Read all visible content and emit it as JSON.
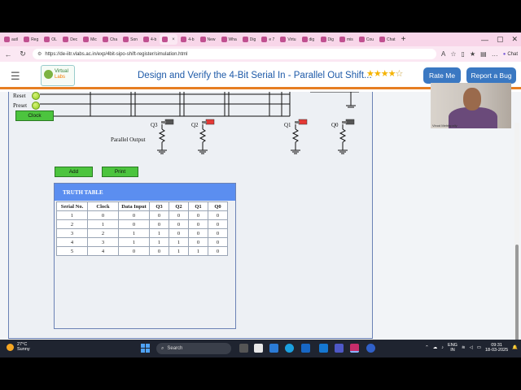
{
  "browser": {
    "tabs": [
      "autl",
      "Reg",
      "OL",
      "Dec",
      "Mic",
      "Cha",
      "Son",
      "4-b",
      "",
      "4-b",
      "New",
      "Wha",
      "Dig",
      "e 7",
      "Virtu",
      "dig",
      "Dig",
      "mis",
      "Cou",
      "Chat"
    ],
    "active_tab": 8,
    "url": "https://de-iitr.vlabs.ac.in/exp/4bit-sipo-shift-register/simulation.html",
    "chat_label": "Chat"
  },
  "header": {
    "logo_line1": "Virtual",
    "logo_line2": "Labs",
    "title": "Design and Verify the 4-Bit Serial In - Parallel Out Shift...",
    "rating": 4,
    "rating_max": 5,
    "rate_button": "Rate Me",
    "bug_button": "Report a Bug"
  },
  "circuit": {
    "reset_label": "Reset",
    "preset_label": "Preset",
    "clock_button": "Clock",
    "parallel_output_label": "Parallel Output",
    "outputs": [
      {
        "label": "Q3",
        "led": "#555555"
      },
      {
        "label": "Q2",
        "led": "#e53935"
      },
      {
        "label": "Q1",
        "led": "#e53935"
      },
      {
        "label": "Q0",
        "led": "#555555"
      }
    ]
  },
  "controls": {
    "add_button": "Add",
    "print_button": "Print"
  },
  "truth_table": {
    "title": "TRUTH TABLE",
    "columns": [
      "Serial No.",
      "Clock",
      "Data Input",
      "Q3",
      "Q2",
      "Q1",
      "Q0"
    ],
    "rows": [
      [
        "1",
        "0",
        "0",
        "0",
        "0",
        "0",
        "0"
      ],
      [
        "2",
        "1",
        "0",
        "0",
        "0",
        "0",
        "0"
      ],
      [
        "3",
        "2",
        "1",
        "1",
        "0",
        "0",
        "0"
      ],
      [
        "4",
        "3",
        "1",
        "1",
        "1",
        "0",
        "0"
      ],
      [
        "5",
        "4",
        "0",
        "0",
        "1",
        "1",
        "0"
      ]
    ]
  },
  "webcam": {
    "label": "Vinod Mehtapally"
  },
  "taskbar": {
    "weather_temp": "27°C",
    "weather_desc": "Sunny",
    "search_placeholder": "Search",
    "lang1": "ENG",
    "lang2": "IN",
    "time": "09:31",
    "date": "18-03-2025"
  }
}
